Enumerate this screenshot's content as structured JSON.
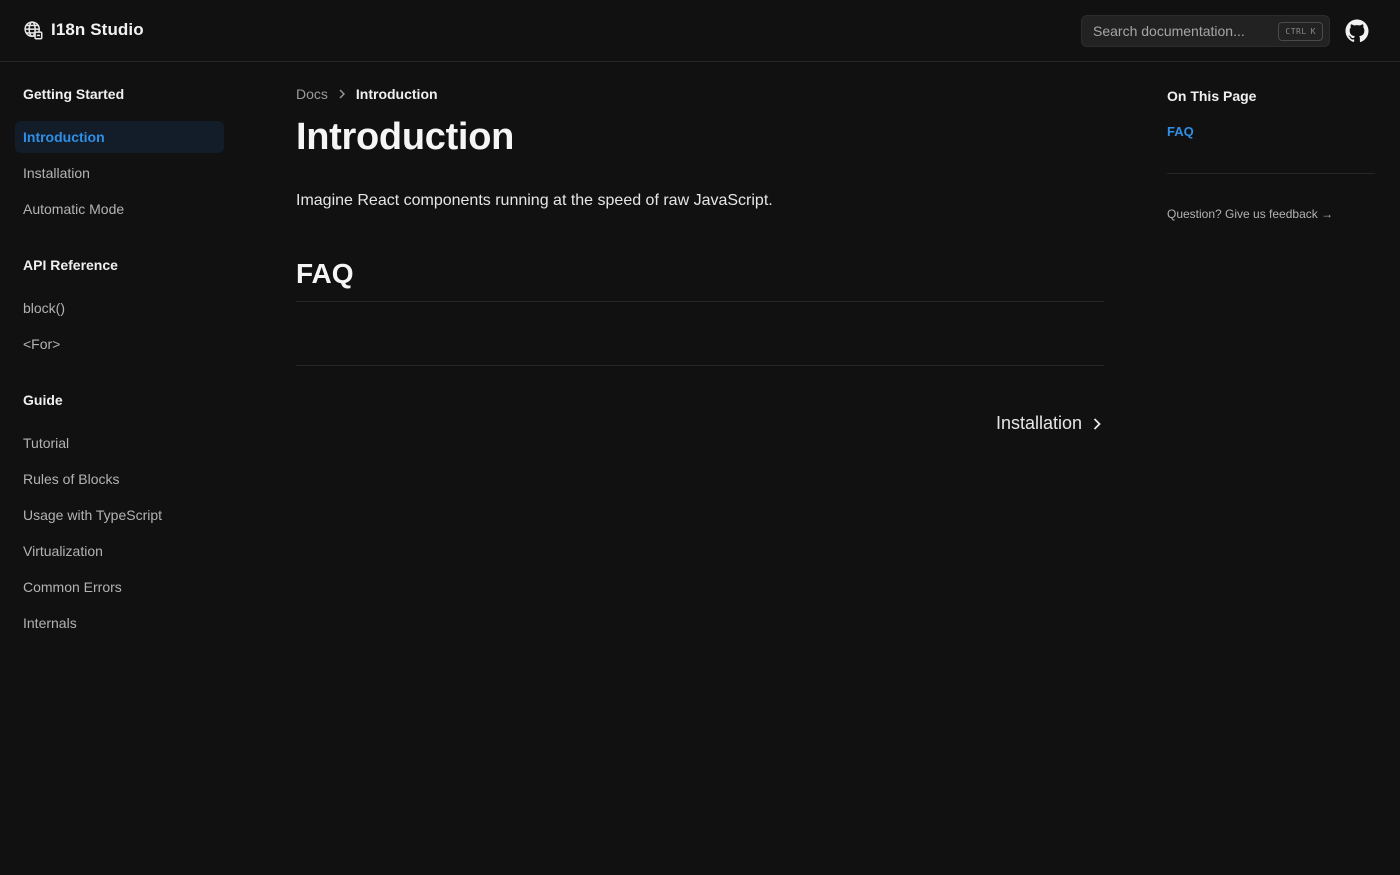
{
  "header": {
    "brand": "I18n Studio",
    "brand_icon": "globe-icon",
    "search_placeholder": "Search documentation...",
    "search_shortcut": [
      "CTRL",
      "K"
    ],
    "github_icon": "github-icon"
  },
  "sidebar": {
    "sections": [
      {
        "heading": "Getting Started",
        "items": [
          {
            "label": "Introduction",
            "active": true
          },
          {
            "label": "Installation",
            "active": false
          },
          {
            "label": "Automatic Mode",
            "active": false
          }
        ]
      },
      {
        "heading": "API Reference",
        "items": [
          {
            "label": "block()",
            "active": false
          },
          {
            "label": "<For>",
            "active": false
          }
        ]
      },
      {
        "heading": "Guide",
        "items": [
          {
            "label": "Tutorial",
            "active": false
          },
          {
            "label": "Rules of Blocks",
            "active": false
          },
          {
            "label": "Usage with TypeScript",
            "active": false
          },
          {
            "label": "Virtualization",
            "active": false
          },
          {
            "label": "Common Errors",
            "active": false
          },
          {
            "label": "Internals",
            "active": false
          }
        ]
      }
    ]
  },
  "main": {
    "breadcrumb": {
      "root": "Docs",
      "current": "Introduction"
    },
    "title": "Introduction",
    "lead": "Imagine React components running at the speed of raw JavaScript.",
    "section_heading": "FAQ",
    "next_link": "Installation"
  },
  "toc": {
    "title": "On This Page",
    "items": [
      "FAQ"
    ],
    "feedback": "Question? Give us feedback →"
  },
  "colors": {
    "background": "#111111",
    "accent": "#2f8fe6",
    "active_bg": "#131d29"
  }
}
